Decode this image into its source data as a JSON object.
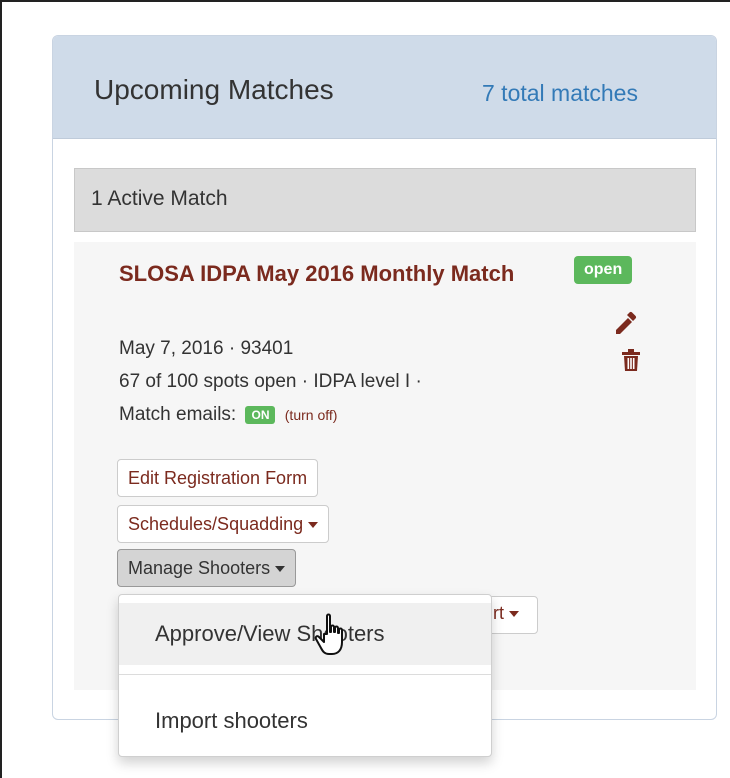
{
  "panel": {
    "title": "Upcoming Matches",
    "total_link": "7 total matches"
  },
  "active_header": "1 Active Match",
  "match": {
    "title": "SLOSA IDPA May 2016 Monthly Match",
    "status_badge": "open",
    "date_zip": "May 7, 2016 · 93401",
    "spots_level": "67 of 100 spots open · IDPA level I ·",
    "emails_label": "Match emails:",
    "emails_status": "ON",
    "turn_off_link": "(turn off)"
  },
  "buttons": {
    "edit_registration": "Edit Registration Form",
    "schedules": "Schedules/Squadding",
    "manage_shooters": "Manage Shooters",
    "hidden_partial": "rt"
  },
  "dropdown": {
    "items": [
      "Approve/View Shooters",
      "Import shooters"
    ]
  },
  "colors": {
    "heading_bg": "#cfdbe9",
    "link_blue": "#337ab7",
    "match_title": "#7b2a1e",
    "badge_green": "#5cb85c"
  },
  "icons": {
    "edit": "pencil-icon",
    "delete": "trash-icon",
    "cursor": "hand-pointer-icon"
  }
}
